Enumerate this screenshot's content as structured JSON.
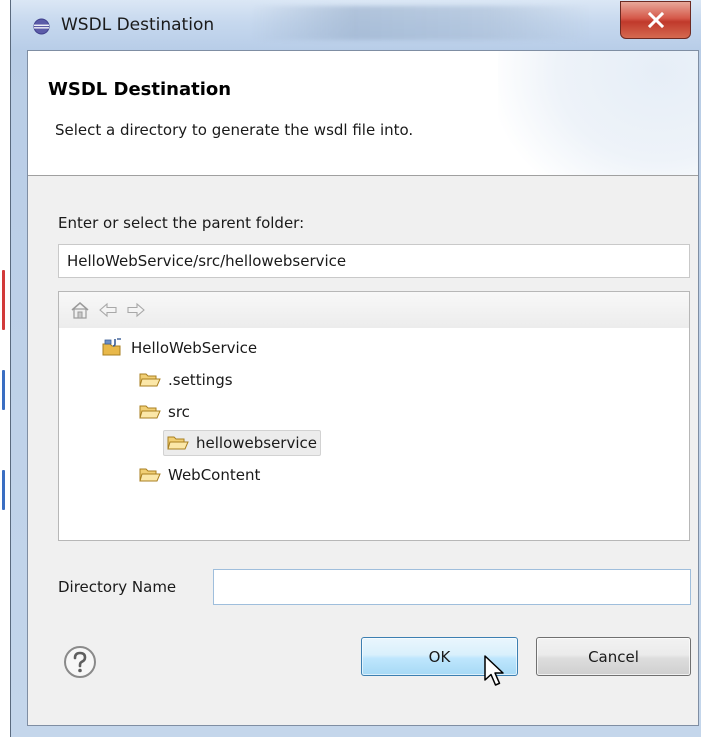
{
  "window": {
    "title": "WSDL Destination"
  },
  "header": {
    "title": "WSDL Destination",
    "description": "Select a directory to generate the wsdl file into."
  },
  "parent_folder": {
    "label": "Enter or select the parent folder:",
    "value": "HelloWebService/src/hellowebservice"
  },
  "tree": {
    "toolbar_icons": [
      "home-icon",
      "back-arrow-icon",
      "forward-arrow-icon"
    ],
    "items": [
      {
        "label": "HelloWebService",
        "icon": "java-project-icon",
        "depth": 0,
        "selected": false
      },
      {
        "label": ".settings",
        "icon": "folder-icon",
        "depth": 1,
        "selected": false
      },
      {
        "label": "src",
        "icon": "folder-icon",
        "depth": 1,
        "selected": false
      },
      {
        "label": "hellowebservice",
        "icon": "folder-icon",
        "depth": 2,
        "selected": true
      },
      {
        "label": "WebContent",
        "icon": "folder-icon",
        "depth": 1,
        "selected": false
      }
    ]
  },
  "directory_name": {
    "label": "Directory Name",
    "value": ""
  },
  "buttons": {
    "ok": "OK",
    "cancel": "Cancel",
    "help_icon": "help-icon"
  },
  "colors": {
    "dialog_bg": "#f0f0f0",
    "ok_button_accent": "#3c7fb1",
    "close_button": "#c0392b",
    "folder": "#e8b84a"
  }
}
